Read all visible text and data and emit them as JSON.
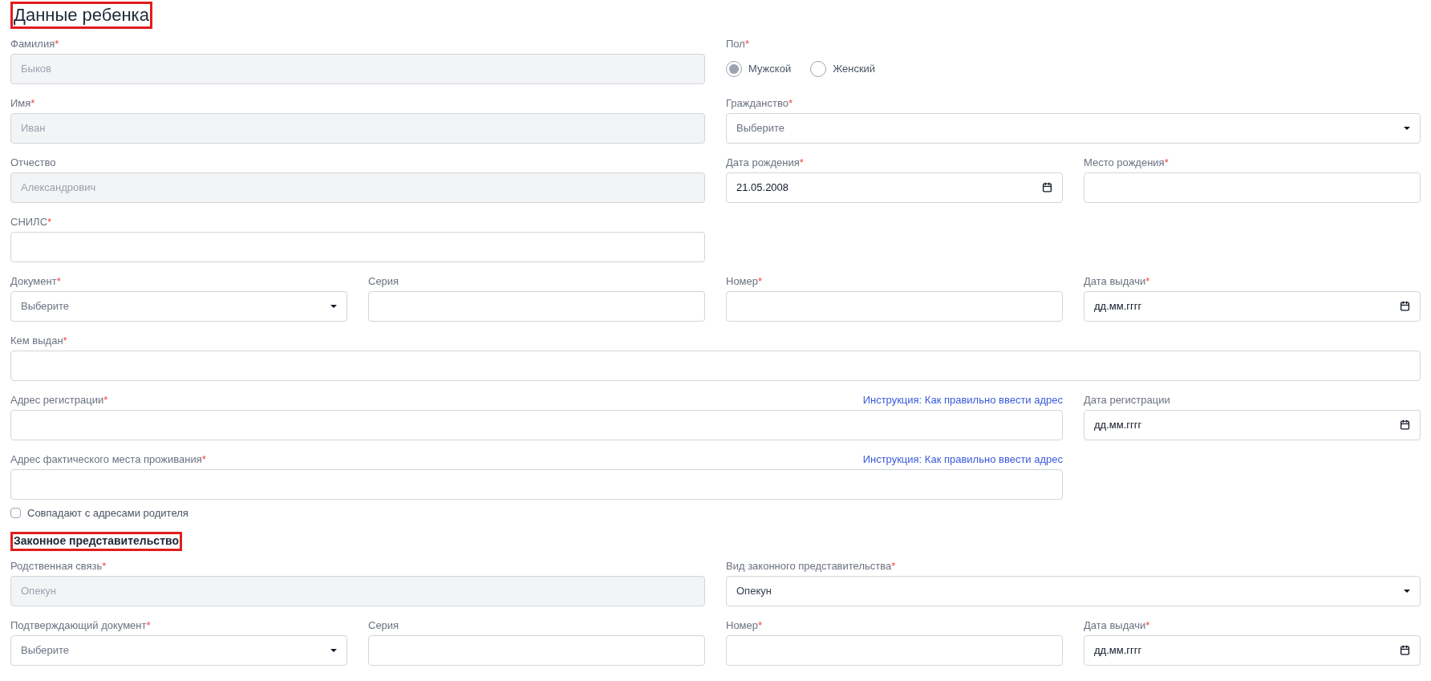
{
  "sections": [
    {
      "title": "Данные ребенка",
      "highlighted": true,
      "kind": "main",
      "fields": [
        {
          "kind": "text",
          "label": "Фамилия",
          "asterisk": "*",
          "disabled": true,
          "value": "Быков"
        },
        {
          "kind": "radio",
          "label": "Пол",
          "asterisk": "*",
          "options": [
            {
              "label": "Мужской",
              "selected": true
            },
            {
              "label": "Женский",
              "selected": false
            }
          ]
        },
        {
          "kind": "text",
          "label": "Имя",
          "asterisk": "*",
          "disabled": true,
          "value": "Иван"
        },
        {
          "kind": "select",
          "label": "Гражданство",
          "asterisk": "*",
          "disabled": false,
          "placeholder": "Выберите"
        },
        {
          "kind": "text",
          "label": "Отчество",
          "disabled": true,
          "value": "Александрович"
        },
        {
          "kind": "date",
          "label": "Дата рождения",
          "asterisk": "*",
          "value": "21.05.2008"
        },
        {
          "kind": "text",
          "label": "Место рождения",
          "asterisk": "*",
          "disabled": false
        },
        {
          "kind": "text",
          "label": "СНИЛС",
          "asterisk": "*",
          "disabled": false
        },
        {
          "kind": "select",
          "label": "Документ",
          "asterisk": "*",
          "disabled": false,
          "placeholder": "Выберите"
        },
        {
          "kind": "text",
          "label": "Серия",
          "disabled": false
        },
        {
          "kind": "text",
          "label": "Номер",
          "asterisk": "*",
          "disabled": false
        },
        {
          "kind": "date",
          "label": "Дата выдачи",
          "asterisk": "*",
          "placeholder": "дд.мм.гггг"
        },
        {
          "kind": "text",
          "label": "Кем выдан",
          "asterisk": "*",
          "disabled": false
        },
        {
          "kind": "text",
          "label": "Адрес регистрации",
          "asterisk": "*",
          "disabled": false,
          "link": "Инструкция: Как правильно ввести адрес"
        },
        {
          "kind": "date",
          "label": "Дата регистрации",
          "placeholder": "дд.мм.гггг"
        },
        {
          "kind": "text",
          "label": "Адрес фактического места проживания",
          "asterisk": "*",
          "disabled": false,
          "link": "Инструкция: Как правильно ввести адрес"
        },
        {
          "kind": "checkbox",
          "label": "Совпадают с адресами родителя",
          "checked": false
        }
      ]
    },
    {
      "title": "Законное представительство",
      "highlighted": true,
      "kind": "sub",
      "fields": [
        {
          "kind": "text",
          "label": "Родственная связь",
          "asterisk": "*",
          "disabled": true,
          "value": "Опекун"
        },
        {
          "kind": "select",
          "label": "Вид законного представительства",
          "asterisk": "*",
          "disabled": false,
          "value": "Опекун"
        },
        {
          "kind": "select",
          "label": "Подтверждающий документ",
          "asterisk": "*",
          "disabled": false,
          "placeholder": "Выберите"
        },
        {
          "kind": "text",
          "label": "Серия",
          "disabled": false
        },
        {
          "kind": "text",
          "label": "Номер",
          "asterisk": "*",
          "disabled": false
        },
        {
          "kind": "date",
          "label": "Дата выдачи",
          "asterisk": "*",
          "placeholder": "дд.мм.гггг"
        }
      ]
    }
  ]
}
